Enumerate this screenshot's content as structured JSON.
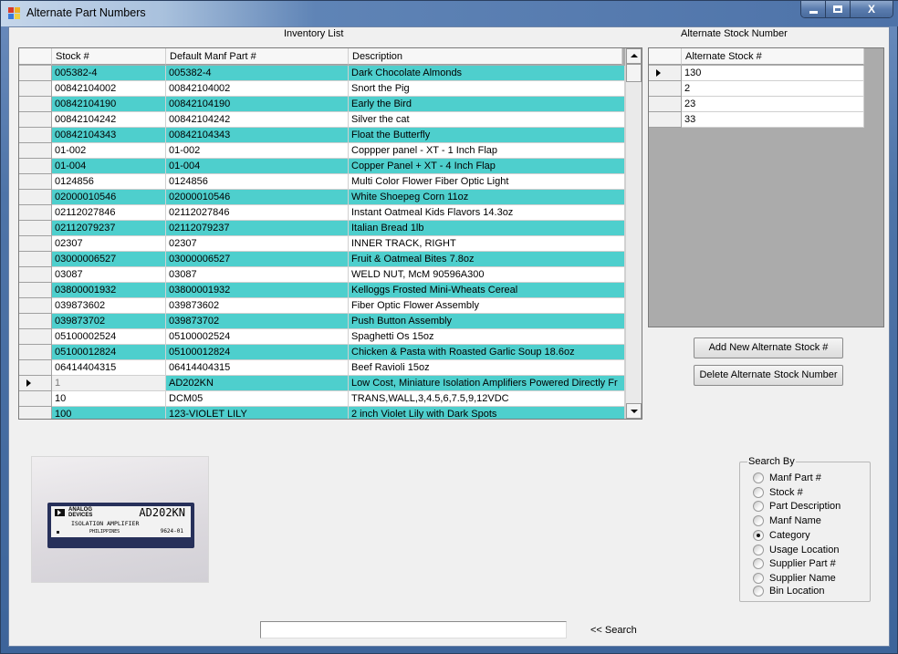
{
  "window": {
    "title": "Alternate Part Numbers",
    "controls": {
      "minimize": "–",
      "maximize": "□",
      "close": "X"
    }
  },
  "inventory": {
    "label": "Inventory List",
    "columns": [
      "Stock #",
      "Default Manf Part #",
      "Description"
    ],
    "rows": [
      {
        "stock": "005382-4",
        "manf": "005382-4",
        "desc": "Dark Chocolate Almonds"
      },
      {
        "stock": "00842104002",
        "manf": "00842104002",
        "desc": "Snort the Pig"
      },
      {
        "stock": "00842104190",
        "manf": "00842104190",
        "desc": "Early the Bird"
      },
      {
        "stock": "00842104242",
        "manf": "00842104242",
        "desc": "Silver the cat"
      },
      {
        "stock": "00842104343",
        "manf": "00842104343",
        "desc": "Float the Butterfly"
      },
      {
        "stock": "01-002",
        "manf": "01-002",
        "desc": "Coppper panel - XT - 1 Inch Flap"
      },
      {
        "stock": "01-004",
        "manf": "01-004",
        "desc": "Copper Panel + XT - 4 Inch Flap"
      },
      {
        "stock": "0124856",
        "manf": "0124856",
        "desc": "Multi Color Flower Fiber Optic Light"
      },
      {
        "stock": "02000010546",
        "manf": "02000010546",
        "desc": "White Shoepeg Corn 11oz"
      },
      {
        "stock": "02112027846",
        "manf": "02112027846",
        "desc": "Instant Oatmeal Kids Flavors 14.3oz"
      },
      {
        "stock": "02112079237",
        "manf": "02112079237",
        "desc": "Italian Bread 1lb"
      },
      {
        "stock": "02307",
        "manf": "02307",
        "desc": "INNER TRACK, RIGHT"
      },
      {
        "stock": "03000006527",
        "manf": "03000006527",
        "desc": "Fruit & Oatmeal Bites 7.8oz"
      },
      {
        "stock": "03087",
        "manf": "03087",
        "desc": "WELD NUT, McM 90596A300"
      },
      {
        "stock": "03800001932",
        "manf": "03800001932",
        "desc": "Kelloggs Frosted Mini-Wheats Cereal"
      },
      {
        "stock": "039873602",
        "manf": "039873602",
        "desc": "Fiber Optic Flower Assembly"
      },
      {
        "stock": "039873702",
        "manf": "039873702",
        "desc": "Push Button Assembly"
      },
      {
        "stock": "05100002524",
        "manf": "05100002524",
        "desc": "Spaghetti Os 15oz"
      },
      {
        "stock": "05100012824",
        "manf": "05100012824",
        "desc": "Chicken & Pasta with Roasted Garlic Soup 18.6oz"
      },
      {
        "stock": "06414404315",
        "manf": "06414404315",
        "desc": "Beef Ravioli 15oz"
      },
      {
        "stock": "1",
        "manf": "AD202KN",
        "desc": "Low Cost, Miniature Isolation Amplifiers Powered Directly Fr",
        "selected": true
      },
      {
        "stock": "10",
        "manf": "DCM05",
        "desc": "TRANS,WALL,3,4.5,6,7.5,9,12VDC"
      },
      {
        "stock": "100",
        "manf": "123-VIOLET LILY",
        "desc": "2 inch Violet Lily with Dark Spots"
      }
    ]
  },
  "alternate": {
    "label": "Alternate Stock Number",
    "column": "Alternate Stock #",
    "rows": [
      "130",
      "2",
      "23",
      "33"
    ],
    "add_button": "Add New Alternate Stock #",
    "delete_button": "Delete Alternate Stock Number"
  },
  "image": {
    "brand_line1": "ANALOG",
    "brand_line2": "DEVICES",
    "model": "AD202KN",
    "subtitle": "ISOLATION AMPLIFIER",
    "origin": "PHILIPPINES",
    "lot": "9624-01"
  },
  "search_by": {
    "legend": "Search By",
    "options": [
      "Manf Part #",
      "Stock #",
      "Part Description",
      "Manf Name",
      "Category",
      "Usage Location",
      "Supplier Part #",
      "Supplier Name",
      "Bin Location"
    ],
    "selected": "Category"
  },
  "search": {
    "value": "",
    "button": "<< Search"
  },
  "colors": {
    "alt_row": "#4ecfcd",
    "row": "#ffffff"
  }
}
